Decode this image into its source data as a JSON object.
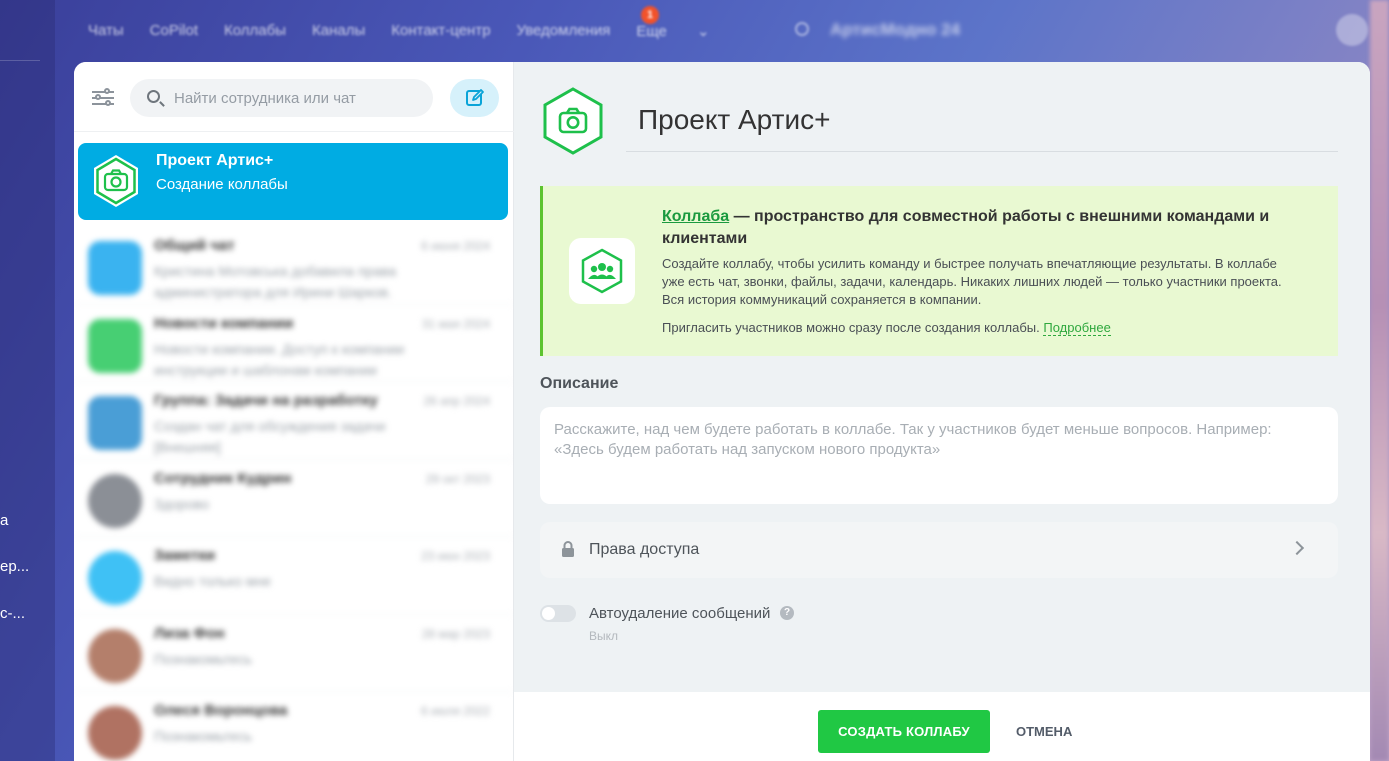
{
  "topnav": {
    "items": [
      "Чаты",
      "CoPilot",
      "Коллабы",
      "Каналы",
      "Контакт-центр",
      "Уведомления",
      "Еще"
    ],
    "notifications_badge": "1",
    "brand": "АртисМодно 24"
  },
  "left_strip": {
    "fragments": [
      "а",
      "ер...",
      "с-..."
    ]
  },
  "chat_panel": {
    "search_placeholder": "Найти сотрудника или чат",
    "active_chat": {
      "title": "Проект Артис+",
      "subtitle": "Создание коллабы"
    },
    "chats": [
      {
        "name": "Общий чат",
        "date": "6 июня 2024",
        "preview": "Кристина Мотовська добавила права администратора для Ирини Шарков.",
        "avatar_color": "#3ab3f0"
      },
      {
        "name": "Новости компании",
        "date": "31 мая 2024",
        "preview": "Новости компании. Доступ к компании инструкции и шаблонам компании",
        "avatar_color": "#47cf73"
      },
      {
        "name": "Группа: Задачи на разработку",
        "date": "26 апр 2024",
        "preview": "Создан чат для обсуждения задачи [Внешняя]",
        "avatar_color": "#4a9ed6"
      },
      {
        "name": "Сотрудник Кудрин",
        "date": "29 окт 2023",
        "preview": "Здорово",
        "avatar_color": "#8b8f96"
      },
      {
        "name": "Заметки",
        "date": "23 июн 2023",
        "preview": "Видно только мне",
        "avatar_color": "#3fc1f5"
      },
      {
        "name": "Лиза Фон",
        "date": "28 мар 2023",
        "preview": "Познакомьтесь",
        "avatar_color": "#b47f6b"
      },
      {
        "name": "Олеся Воронцова",
        "date": "6 июля 2022",
        "preview": "Познакомьтесь",
        "avatar_color": "#b07262"
      }
    ]
  },
  "form": {
    "title": "Проект Артис+",
    "info": {
      "link_text": "Коллаба",
      "head_rest": " — пространство для совместной работы с внешними командами и клиентами",
      "body": "Создайте коллабу, чтобы усилить команду и быстрее получать впечатляющие результаты. В коллабе уже есть чат, звонки, файлы, задачи, календарь. Никаких лишних людей — только участники проекта. Вся история коммуникаций сохраняется в компании.",
      "foot": "Пригласить участников можно сразу после создания коллабы.",
      "more": "Подробнее"
    },
    "description_label": "Описание",
    "description_placeholder": "Расскажите, над чем будете работать в коллабе. Так у участников будет меньше вопросов. Например: «Здесь будем работать над запуском нового продукта»",
    "access_label": "Права доступа",
    "autodelete_label": "Автоудаление сообщений",
    "autodelete_state": "Выкл",
    "help_glyph": "?"
  },
  "footer": {
    "create_label": "СОЗДАТЬ КОЛЛАБУ",
    "cancel_label": "ОТМЕНА"
  },
  "colors": {
    "accent_blue": "#00ace3",
    "green": "#20c844",
    "info_bg": "#e9f9d2"
  }
}
